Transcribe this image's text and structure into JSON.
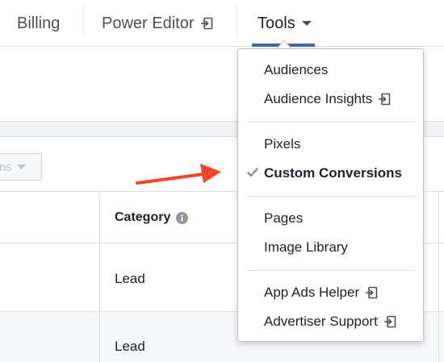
{
  "topnav": {
    "billing_label": "Billing",
    "power_editor_label": "Power Editor",
    "tools_label": "Tools"
  },
  "filter": {
    "label": "ns"
  },
  "table": {
    "category_header": "Category",
    "rows": [
      {
        "category": "Lead"
      },
      {
        "category": "Lead"
      }
    ]
  },
  "tools_menu": {
    "sections": [
      {
        "items": [
          {
            "label": "Audiences"
          },
          {
            "label": "Audience Insights",
            "icon": "external-link-icon"
          }
        ]
      },
      {
        "items": [
          {
            "label": "Pixels"
          },
          {
            "label": "Custom Conversions",
            "selected": true,
            "icon": "checkmark-icon"
          }
        ]
      },
      {
        "items": [
          {
            "label": "Pages"
          },
          {
            "label": "Image Library"
          }
        ]
      },
      {
        "items": [
          {
            "label": "App Ads Helper",
            "icon": "external-link-icon"
          },
          {
            "label": "Advertiser Support",
            "icon": "external-link-icon"
          }
        ]
      }
    ]
  },
  "colors": {
    "accent": "#4267b2",
    "annotation_arrow": "#f0452a",
    "text": "#1d2129",
    "border": "#dddfe2"
  }
}
